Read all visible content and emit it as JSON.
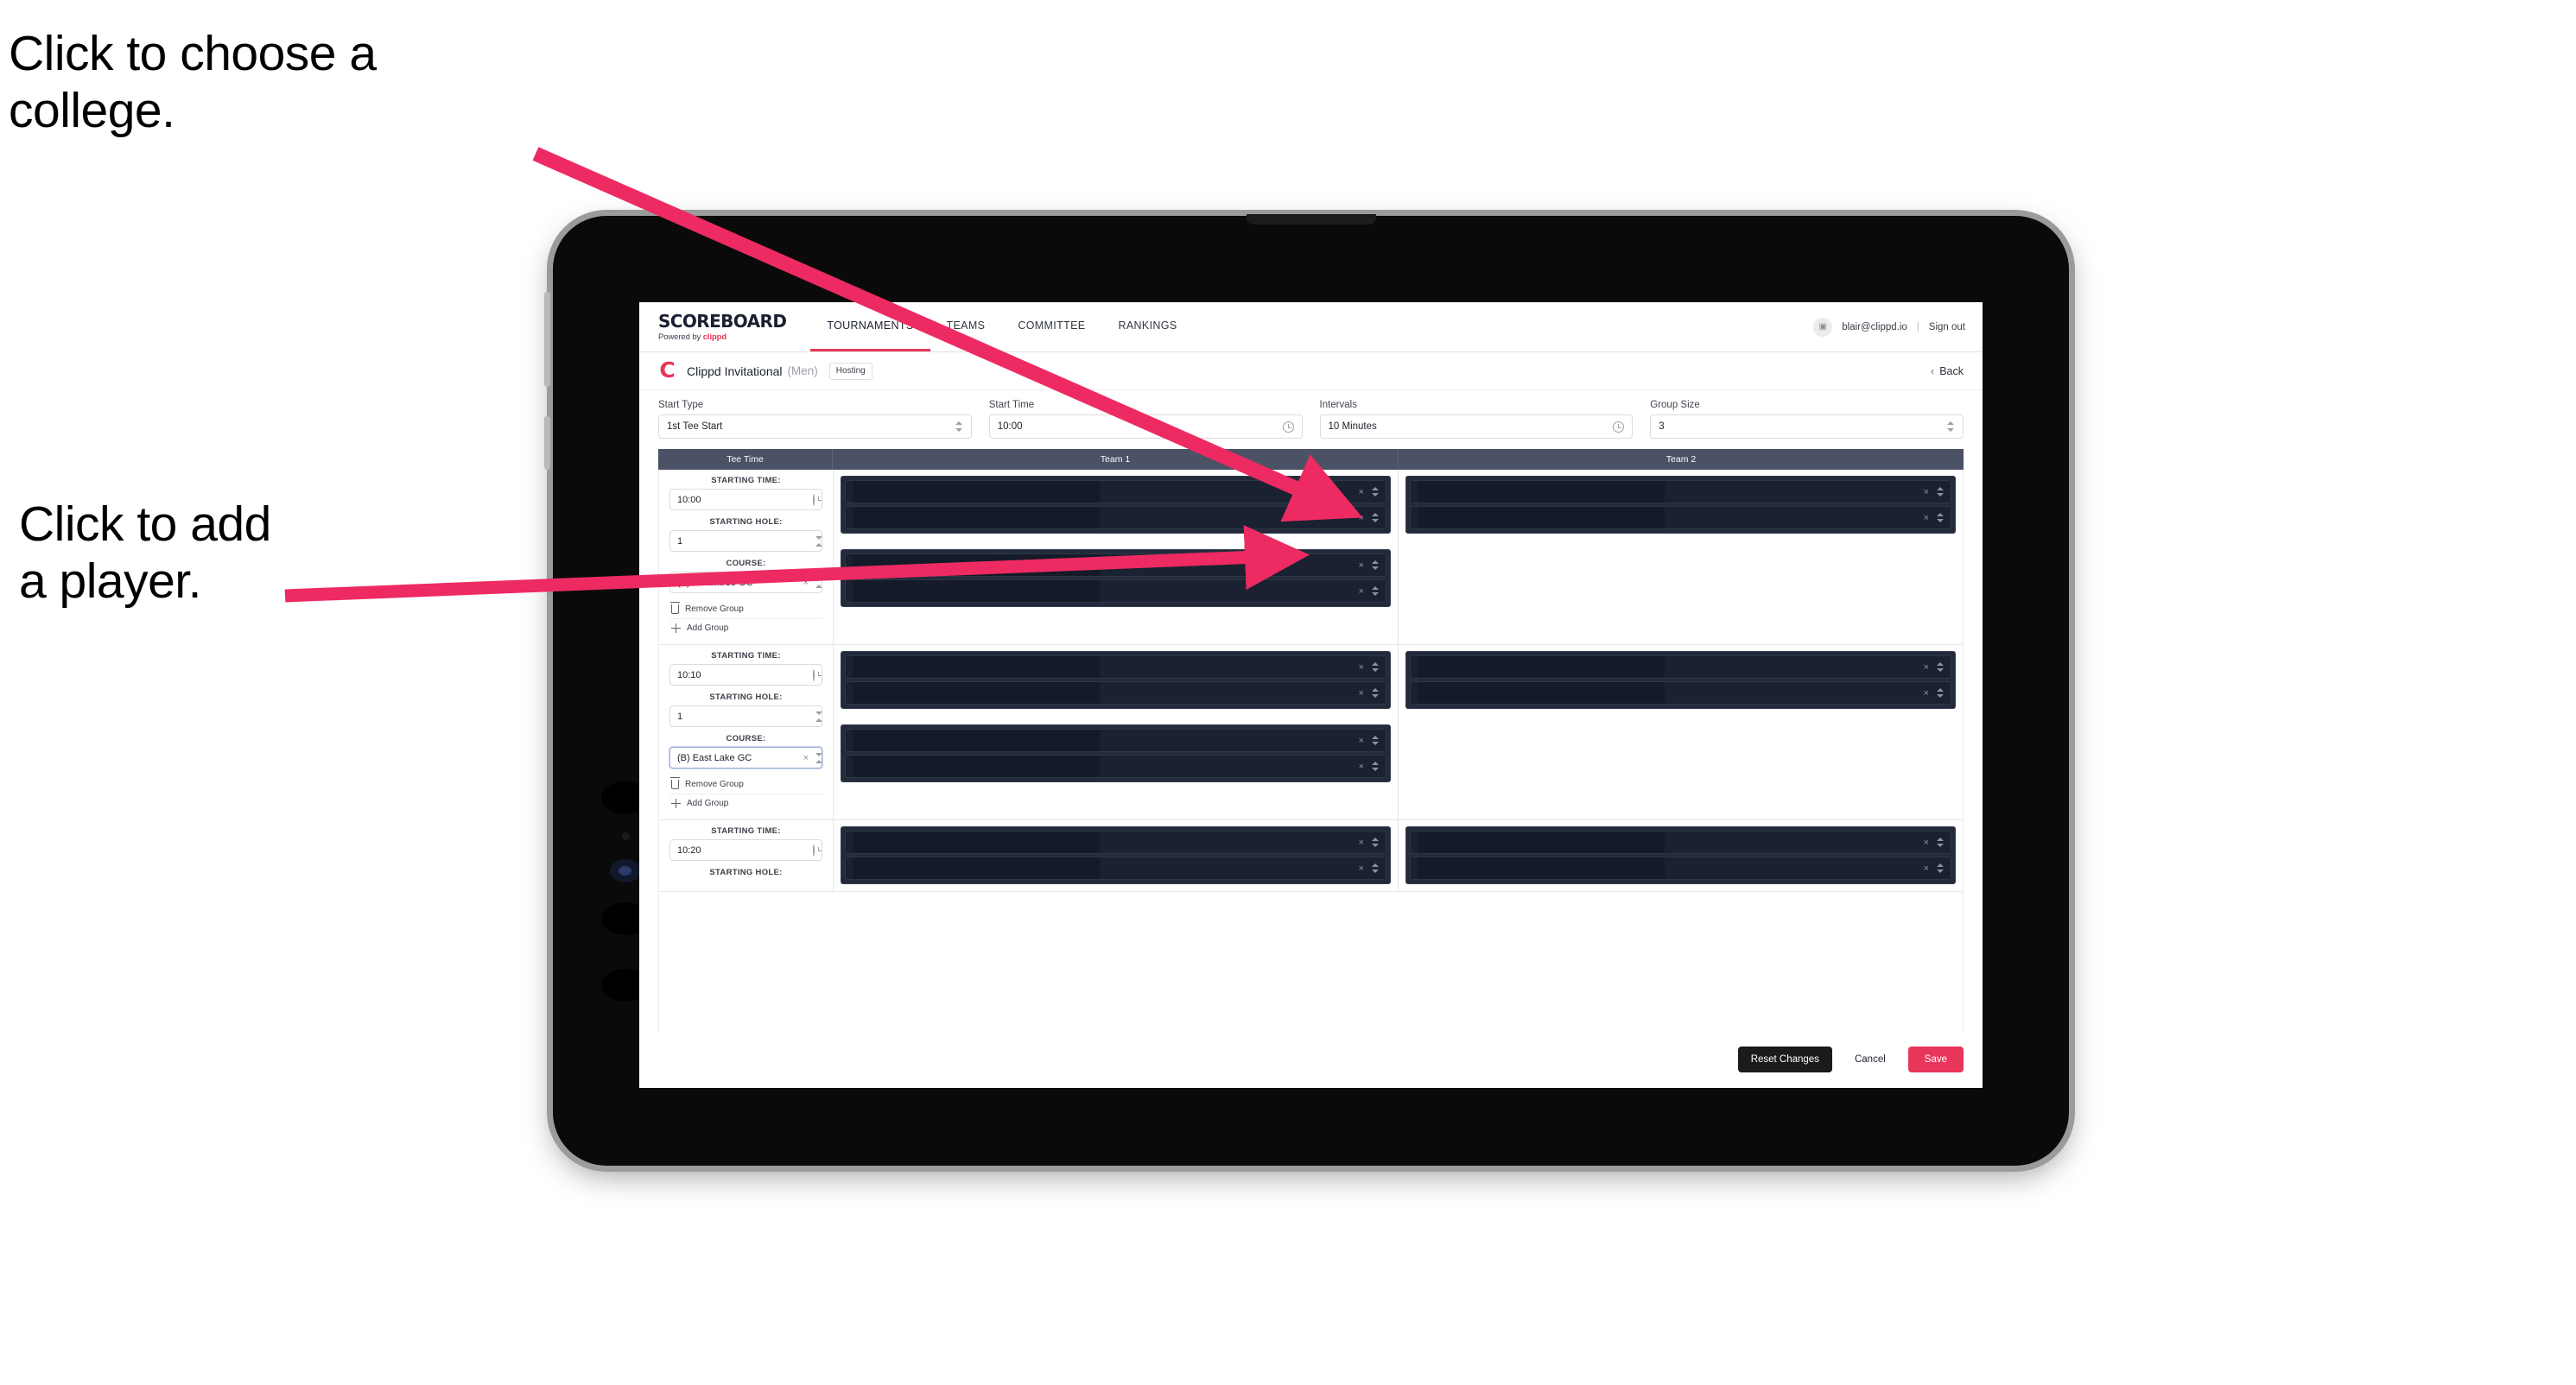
{
  "annotations": {
    "college": "Click to choose a\ncollege.",
    "player": "Click to add\na player."
  },
  "topnav": {
    "logo_main": "SCOREBOARD",
    "logo_sub_prefix": "Powered by ",
    "logo_sub_brand": "clippd",
    "items": [
      {
        "label": "TOURNAMENTS",
        "active": true
      },
      {
        "label": "TEAMS",
        "active": false
      },
      {
        "label": "COMMITTEE",
        "active": false
      },
      {
        "label": "RANKINGS",
        "active": false
      }
    ],
    "avatar_glyph": "▣",
    "email": "blair@clippd.io",
    "separator": "|",
    "sign_out": "Sign out"
  },
  "tournament_header": {
    "logo_letter": "C",
    "name": "Clippd Invitational",
    "gender": "(Men)",
    "badge": "Hosting",
    "back_chevron": "‹",
    "back_label": "Back"
  },
  "settings": {
    "start_type": {
      "label": "Start Type",
      "value": "1st Tee Start",
      "adorn": "stepper"
    },
    "start_time": {
      "label": "Start Time",
      "value": "10:00",
      "adorn": "clock"
    },
    "intervals": {
      "label": "Intervals",
      "value": "10 Minutes",
      "adorn": "clock"
    },
    "group_size": {
      "label": "Group Size",
      "value": "3",
      "adorn": "stepper"
    }
  },
  "table": {
    "headers": {
      "tee_time": "Tee Time",
      "team1": "Team 1",
      "team2": "Team 2"
    },
    "labels": {
      "starting_time": "STARTING TIME:",
      "starting_hole": "STARTING HOLE:",
      "course": "COURSE:",
      "remove_group": "Remove Group",
      "add_group": "Add Group"
    },
    "rows": [
      {
        "starting_time": "10:00",
        "starting_hole": "1",
        "course": "(A) Peachtree GC",
        "course_focused": false,
        "team1_groups": [
          2,
          2
        ],
        "team2_groups": [
          2
        ]
      },
      {
        "starting_time": "10:10",
        "starting_hole": "1",
        "course": "(B) East Lake GC",
        "course_focused": true,
        "team1_groups": [
          2,
          2
        ],
        "team2_groups": [
          2
        ]
      },
      {
        "starting_time": "10:20",
        "starting_hole": "",
        "course": "",
        "course_focused": false,
        "team1_groups": [
          2
        ],
        "team2_groups": [
          2
        ]
      }
    ]
  },
  "footer": {
    "reset": "Reset Changes",
    "cancel": "Cancel",
    "save": "Save"
  },
  "colors": {
    "accent": "#e8355a",
    "table_header": "#4c5266",
    "redacted": "#232b3a",
    "dark_button": "#1b1b1b"
  }
}
